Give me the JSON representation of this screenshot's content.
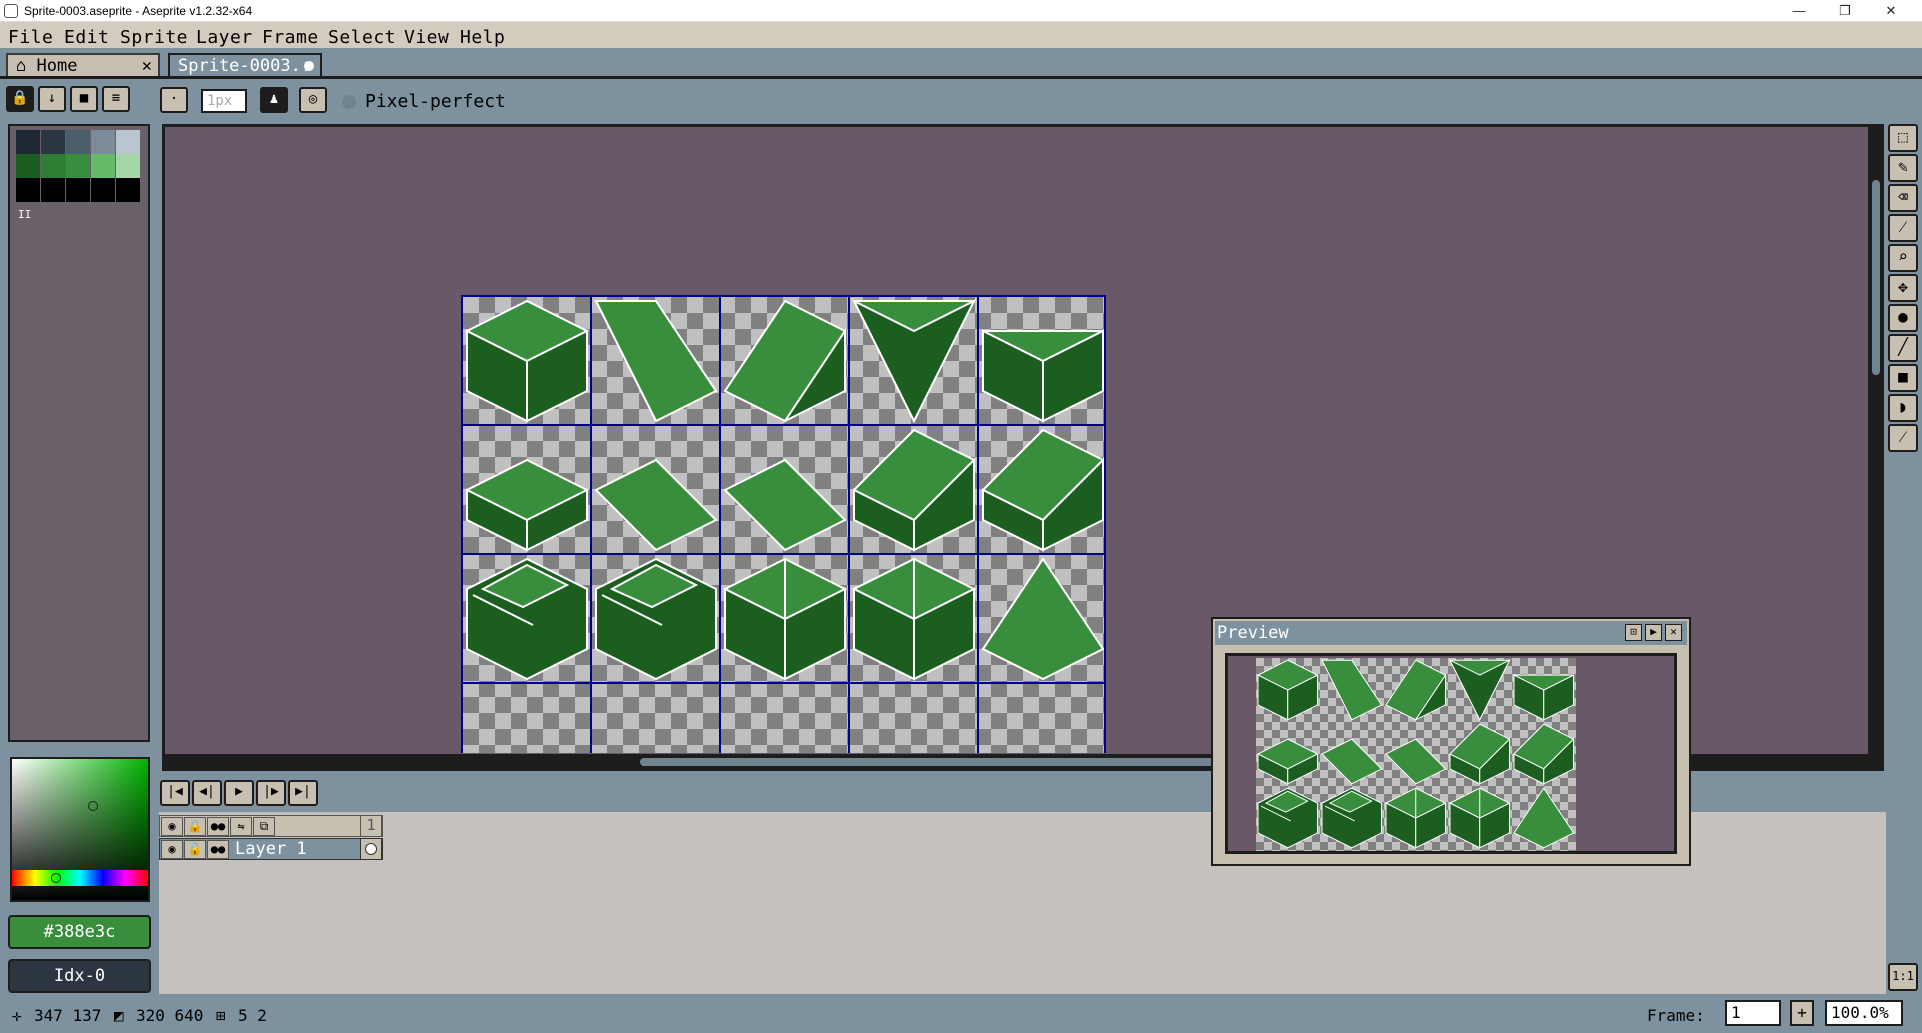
{
  "window": {
    "title": "Sprite-0003.aseprite - Aseprite v1.2.32-x64",
    "min": "—",
    "max": "❐",
    "close": "✕"
  },
  "menu": [
    "File",
    "Edit",
    "Sprite",
    "Layer",
    "Frame",
    "Select",
    "View",
    "Help"
  ],
  "tabs": [
    {
      "label": "Home",
      "icon": "home-icon",
      "close": "✕"
    },
    {
      "label": "Sprite-0003.:",
      "icon": "dot-icon"
    }
  ],
  "contextbar": {
    "brush_size_placeholder": "1px",
    "pixel_perfect_label": "Pixel-perfect"
  },
  "palette": {
    "colors": [
      "#1d2a33",
      "#2b3640",
      "#4a5e6b",
      "#7a8c99",
      "#b9c6cf",
      "#1b5e20",
      "#2e7d32",
      "#388e3c",
      "#66bb6a",
      "#a5d6a7",
      "#000000",
      "#000000",
      "#000000",
      "#000000",
      "#000000"
    ],
    "indicator": "II"
  },
  "colors": {
    "foreground": "#388e3c",
    "foreground_label": "#388e3c",
    "background_label": "Idx-0",
    "accent": "#388e3c",
    "canvas_bg": "#695868",
    "grid": "#00008b"
  },
  "timeline": {
    "layer_name": "Layer 1",
    "frame_number": "1"
  },
  "preview": {
    "title": "Preview"
  },
  "status": {
    "cursor": "347 137",
    "selection": "320 640",
    "grid": "5 2",
    "frame_label": "Frame:",
    "frame_value": "1",
    "add_frame": "+",
    "zoom": "100.0%"
  },
  "toolbar_icons": [
    "rect-marquee-icon",
    "pencil-icon",
    "eraser-icon",
    "eyedropper-icon",
    "zoom-icon",
    "move-icon",
    "paint-bucket-icon",
    "line-icon",
    "rectangle-icon",
    "contour-icon",
    "blur-icon"
  ]
}
